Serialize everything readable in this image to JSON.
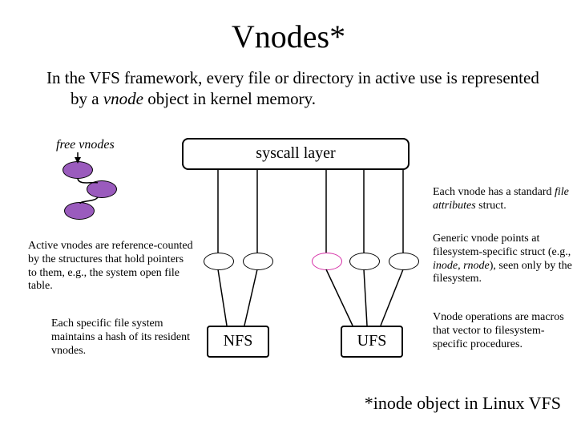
{
  "title": "Vnodes*",
  "intro_html": "In the VFS framework, every file or directory in active use is represented by a <i>vnode</i> object in kernel memory.",
  "labels": {
    "free_vnodes": "free vnodes",
    "syscall": "syscall layer",
    "nfs": "NFS",
    "ufs": "UFS"
  },
  "notes": {
    "attr_struct": "Each vnode has a standard <i>file attributes</i> struct.",
    "generic_vnode": "Generic vnode points at filesystem-specific struct (e.g., <i>inode, rnode</i>), seen only by the filesystem.",
    "vnode_ops": "Vnode operations are macros that vector to filesystem-specific procedures.",
    "active_refcount": "Active vnodes are reference-counted by the structures that hold pointers to them, e.g., the system open file table.",
    "fs_hash": "Each specific file system maintains a hash of its resident vnodes."
  },
  "footnote": "*inode object in Linux VFS",
  "colors": {
    "free_vnode_fill": "#9a5bbd",
    "magenta_oval": "#d62da6"
  }
}
